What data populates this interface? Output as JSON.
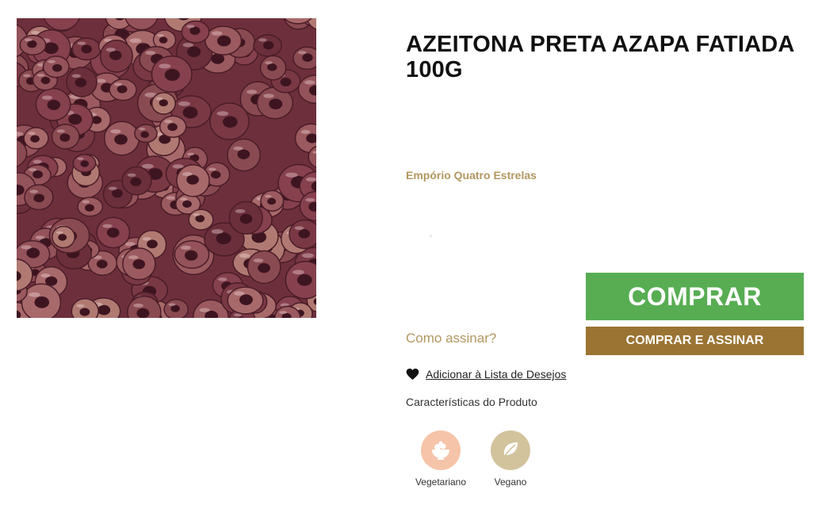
{
  "product": {
    "title": "AZEITONA PRETA AZAPA FATIADA 100G",
    "brand": "Empório Quatro Estrelas",
    "image_icon": "sliced-olives-photo"
  },
  "actions": {
    "buy_label": "COMPRAR",
    "subscribe_label": "COMPRAR E ASSINAR",
    "how_subscribe_label": "Como assinar?",
    "wishlist_label": "Adicionar à Lista de Desejos"
  },
  "characteristics": {
    "title": "Características do Produto",
    "items": [
      {
        "label": "Vegetariano",
        "icon": "salad-bowl-icon",
        "color": "#f6c4a8"
      },
      {
        "label": "Vegano",
        "icon": "leaf-icon",
        "color": "#d2c39d"
      }
    ]
  },
  "colors": {
    "buy": "#58ad53",
    "subscribe": "#9b7433",
    "brand_text": "#b3975f"
  }
}
